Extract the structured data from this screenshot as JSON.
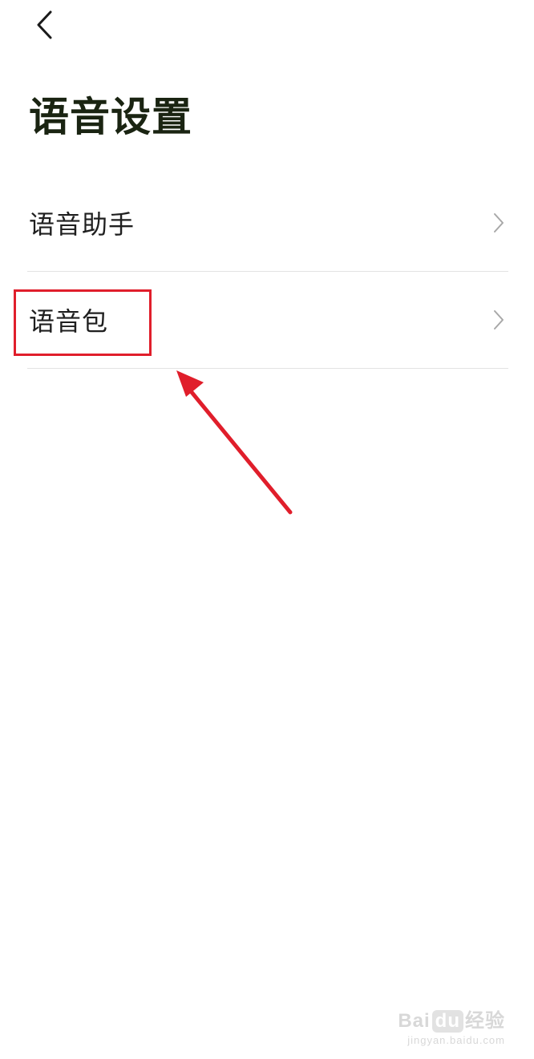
{
  "header": {
    "back_icon": "chevron-left-icon",
    "title": "语音设置"
  },
  "settings": {
    "items": [
      {
        "label": "语音助手",
        "icon": "chevron-right-icon"
      },
      {
        "label": "语音包",
        "icon": "chevron-right-icon",
        "highlighted": true
      }
    ]
  },
  "annotation": {
    "color": "#e01e2b",
    "arrow_icon": "red-arrow"
  },
  "watermark": {
    "brand_pre": "Bai",
    "brand_du": "du",
    "brand_post": "经验",
    "url": "jingyan.baidu.com"
  }
}
